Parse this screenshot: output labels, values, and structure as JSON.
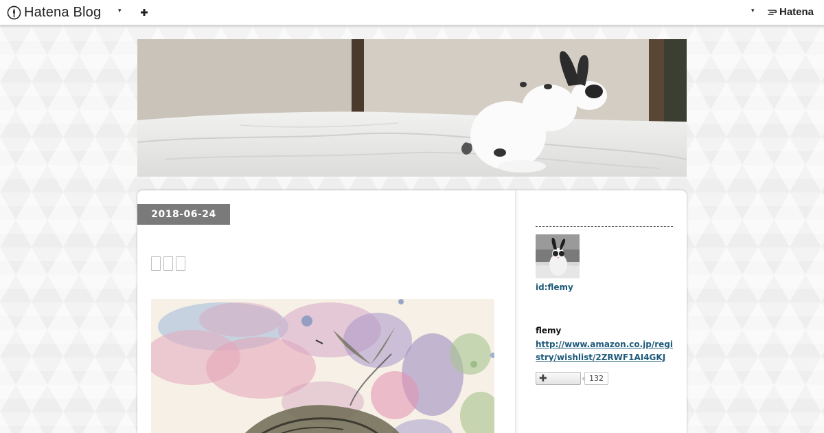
{
  "global_header": {
    "brand_label": "Hatena Blog",
    "brand_icon": "hatena-blog-logo-icon",
    "menu_caret": "▾",
    "add_icon": "plus-icon",
    "account_caret": "▾",
    "hatena_label": "Hatena",
    "hatena_icon": "hatena-logo-icon"
  },
  "entry": {
    "date": "2018-06-24",
    "title_glyph_count": 3,
    "image": "watercolor-cat-painting"
  },
  "sidebar": {
    "user_id": "id:flemy",
    "profile_name": "flemy",
    "profile_link": "http://www.amazon.co.jp/registry/wishlist/2ZRWF1AI4GKJ",
    "subscribe_icon": "plus-icon",
    "subscriber_count": "132"
  },
  "colors": {
    "date_badge": "#7a7a7a",
    "link": "#1e5a7a",
    "background": "#f3f3f3"
  }
}
